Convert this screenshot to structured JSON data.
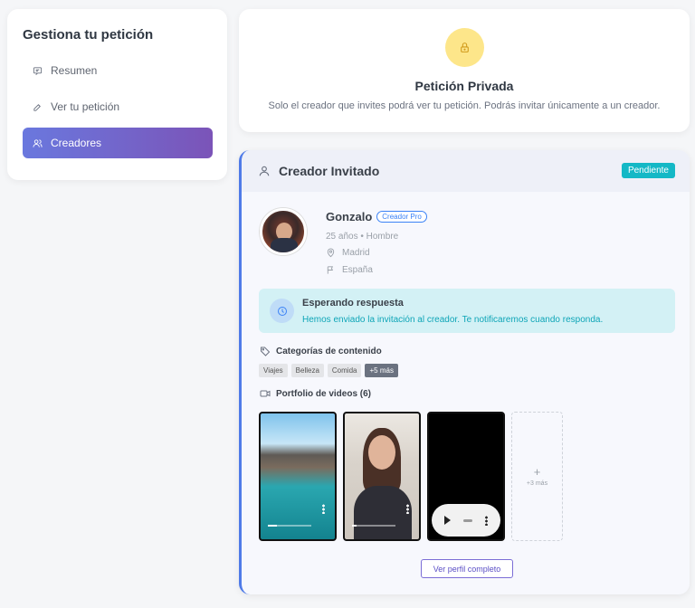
{
  "sidebar": {
    "title": "Gestiona tu petición",
    "items": [
      {
        "label": "Resumen",
        "icon": "message-icon"
      },
      {
        "label": "Ver tu petición",
        "icon": "edit-icon"
      },
      {
        "label": "Creadores",
        "icon": "users-icon",
        "active": true
      }
    ]
  },
  "privacy": {
    "icon": "lock-icon",
    "title": "Petición Privada",
    "description": "Solo el creador que invites podrá ver tu petición. Podrás invitar únicamente a un creador."
  },
  "invited_creator": {
    "header_title": "Creador Invitado",
    "status_badge": "Pendiente",
    "name": "Gonzalo",
    "pro_badge": "Creador Pro",
    "age_gender": "25 años • Hombre",
    "city": "Madrid",
    "country": "España",
    "waiting_title": "Esperando respuesta",
    "waiting_text": "Hemos enviado la invitación al creador. Te notificaremos cuando responda.",
    "categories_title": "Categorías de contenido",
    "categories": [
      "Viajes",
      "Belleza",
      "Comida"
    ],
    "categories_more": "+5 más",
    "portfolio_title": "Portfolio de videos (6)",
    "video_progress": [
      0.2,
      0.1
    ],
    "videos_more": "+3 más",
    "profile_button": "Ver perfil completo"
  },
  "colors": {
    "accent_gradient_start": "#6a78de",
    "accent_gradient_end": "#7b54b8",
    "pending": "#14b8c6",
    "info_bg": "#d3f1f5",
    "info_text": "#0ea5b7",
    "lock_bg": "#fde68a"
  }
}
